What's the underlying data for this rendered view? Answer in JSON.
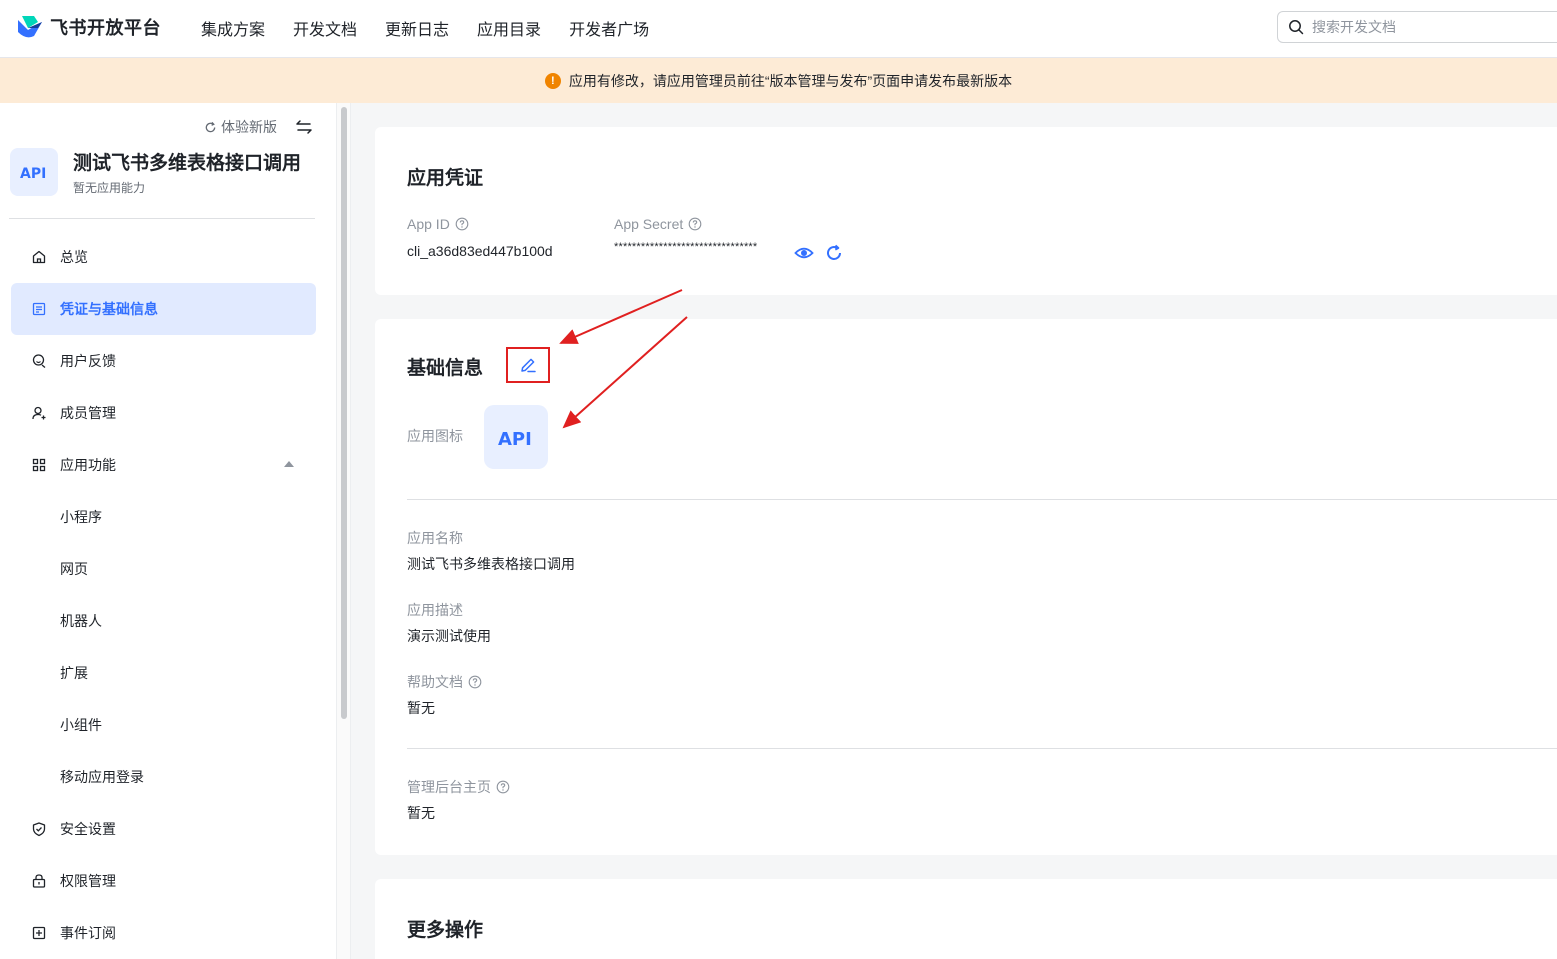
{
  "brand": {
    "name": "飞书开放平台"
  },
  "nav": {
    "items": [
      "集成方案",
      "开发文档",
      "更新日志",
      "应用目录",
      "开发者广场"
    ]
  },
  "search": {
    "placeholder": "搜索开发文档"
  },
  "notice": {
    "text": "应用有修改，请应用管理员前往“版本管理与发布”页面申请发布最新版本"
  },
  "sidebar": {
    "try_new": "体验新版",
    "app_name": "测试飞书多维表格接口调用",
    "app_sub": "暂无应用能力",
    "avatar_text": "API",
    "items": [
      {
        "label": "总览",
        "icon": "home-icon"
      },
      {
        "label": "凭证与基础信息",
        "icon": "document-icon",
        "active": true
      },
      {
        "label": "用户反馈",
        "icon": "feedback-icon"
      },
      {
        "label": "成员管理",
        "icon": "member-icon"
      },
      {
        "label": "应用功能",
        "icon": "grid-icon",
        "expanded": true
      },
      {
        "label": "小程序",
        "sub": true
      },
      {
        "label": "网页",
        "sub": true
      },
      {
        "label": "机器人",
        "sub": true
      },
      {
        "label": "扩展",
        "sub": true
      },
      {
        "label": "小组件",
        "sub": true
      },
      {
        "label": "移动应用登录",
        "sub": true
      },
      {
        "label": "安全设置",
        "icon": "shield-icon"
      },
      {
        "label": "权限管理",
        "icon": "lock-icon"
      },
      {
        "label": "事件订阅",
        "icon": "subscribe-icon"
      }
    ]
  },
  "credentials": {
    "title": "应用凭证",
    "app_id_label": "App ID",
    "app_id_value": "cli_a36d83ed447b100d",
    "app_secret_label": "App Secret",
    "app_secret_value": "********************************"
  },
  "basic": {
    "title": "基础信息",
    "icon_label": "应用图标",
    "icon_text": "API",
    "name_label": "应用名称",
    "name_value": "测试飞书多维表格接口调用",
    "desc_label": "应用描述",
    "desc_value": "演示测试使用",
    "help_label": "帮助文档",
    "help_value": "暂无",
    "admin_label": "管理后台主页",
    "admin_value": "暂无"
  },
  "more": {
    "title": "更多操作"
  },
  "colors": {
    "accent": "#3370ff",
    "warning": "#f08400",
    "annotation": "#e02020"
  }
}
